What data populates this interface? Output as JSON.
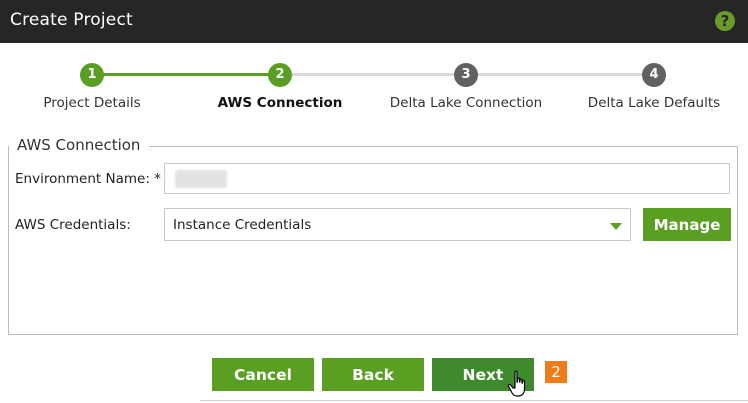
{
  "dialog": {
    "title": "Create Project",
    "help_icon": "?"
  },
  "stepper": {
    "steps": [
      {
        "number": "1",
        "label": "Project Details",
        "state": "done"
      },
      {
        "number": "2",
        "label": "AWS Connection",
        "state": "active"
      },
      {
        "number": "3",
        "label": "Delta Lake Connection",
        "state": "todo"
      },
      {
        "number": "4",
        "label": "Delta Lake Defaults",
        "state": "todo"
      }
    ]
  },
  "form": {
    "legend": "AWS Connection",
    "environment_name_label": "Environment Name: *",
    "environment_name_value": "",
    "aws_credentials_label": "AWS Credentials:",
    "aws_credentials_value": "Instance Credentials",
    "manage_label": "Manage"
  },
  "footer": {
    "cancel_label": "Cancel",
    "back_label": "Back",
    "next_label": "Next",
    "callout_number": "2"
  },
  "colors": {
    "accent_green": "#5a9e22",
    "title_bar": "#262626",
    "callout_orange": "#f07b18"
  }
}
